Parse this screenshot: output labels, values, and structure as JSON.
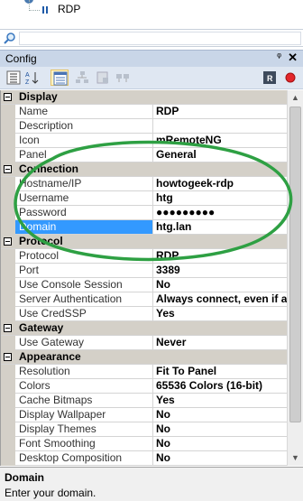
{
  "tree": {
    "node_label": "RDP"
  },
  "panel": {
    "title": "Config",
    "pin_glyph": "ᵠ",
    "close_glyph": "✕"
  },
  "toolbar": {
    "buttons": [
      {
        "icon": "categorized-icon",
        "selected": false
      },
      {
        "icon": "alphabetical-icon",
        "selected": false
      },
      {
        "icon": "properties-icon",
        "selected": true
      },
      {
        "icon": "inheritance-icon",
        "selected": false
      },
      {
        "icon": "default-inheritance-icon",
        "selected": false
      },
      {
        "icon": "default-properties-icon",
        "selected": false
      },
      {
        "icon": "host-status-icon",
        "selected": false
      },
      {
        "icon": "red-circle-icon",
        "selected": false
      }
    ]
  },
  "grid": {
    "rows": [
      {
        "type": "cat",
        "name": "Display"
      },
      {
        "type": "prop",
        "name": "Name",
        "value": "RDP"
      },
      {
        "type": "prop",
        "name": "Description",
        "value": ""
      },
      {
        "type": "prop",
        "name": "Icon",
        "value": "mRemoteNG"
      },
      {
        "type": "prop",
        "name": "Panel",
        "value": "General"
      },
      {
        "type": "cat",
        "name": "Connection"
      },
      {
        "type": "prop",
        "name": "Hostname/IP",
        "value": "howtogeek-rdp"
      },
      {
        "type": "prop",
        "name": "Username",
        "value": "htg"
      },
      {
        "type": "prop",
        "name": "Password",
        "value": "●●●●●●●●●"
      },
      {
        "type": "prop",
        "name": "Domain",
        "value": "htg.lan",
        "selected": true
      },
      {
        "type": "cat",
        "name": "Protocol"
      },
      {
        "type": "prop",
        "name": "Protocol",
        "value": "RDP"
      },
      {
        "type": "prop",
        "name": "Port",
        "value": "3389"
      },
      {
        "type": "prop",
        "name": "Use Console Session",
        "value": "No"
      },
      {
        "type": "prop",
        "name": "Server Authentication",
        "value": "Always connect, even if a"
      },
      {
        "type": "prop",
        "name": "Use CredSSP",
        "value": "Yes"
      },
      {
        "type": "cat",
        "name": "Gateway"
      },
      {
        "type": "prop",
        "name": "Use Gateway",
        "value": "Never"
      },
      {
        "type": "cat",
        "name": "Appearance"
      },
      {
        "type": "prop",
        "name": "Resolution",
        "value": "Fit To Panel"
      },
      {
        "type": "prop",
        "name": "Colors",
        "value": "65536 Colors (16-bit)"
      },
      {
        "type": "prop",
        "name": "Cache Bitmaps",
        "value": "Yes"
      },
      {
        "type": "prop",
        "name": "Display Wallpaper",
        "value": "No"
      },
      {
        "type": "prop",
        "name": "Display Themes",
        "value": "No"
      },
      {
        "type": "prop",
        "name": "Font Smoothing",
        "value": "No"
      },
      {
        "type": "prop",
        "name": "Desktop Composition",
        "value": "No"
      }
    ]
  },
  "description": {
    "heading": "Domain",
    "text": "Enter your domain."
  },
  "colors": {
    "highlight_ellipse": "#2ea043",
    "selection": "#3399ff",
    "category_bg": "#d4d0c8"
  }
}
